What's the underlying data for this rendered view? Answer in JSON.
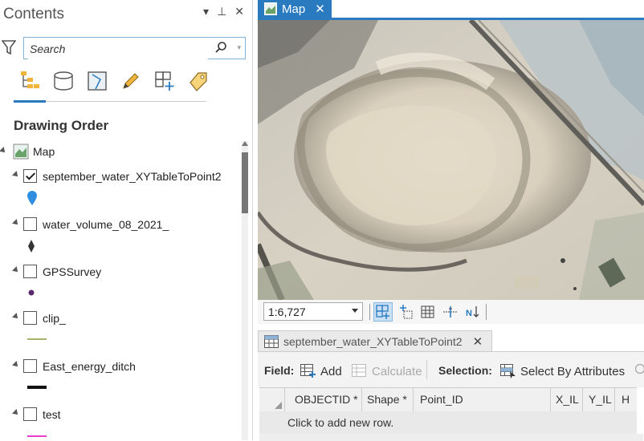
{
  "contents": {
    "title": "Contents",
    "search_placeholder": "Search",
    "section_title": "Drawing Order",
    "map_label": "Map",
    "layers": [
      {
        "label": "september_water_XYTableToPoint2",
        "checked": true,
        "symbol": "blue-pin"
      },
      {
        "label": "water_volume_08_2021_",
        "checked": false,
        "symbol": "black-diamond"
      },
      {
        "label": "GPSSurvey",
        "checked": false,
        "symbol": "purple-dot"
      },
      {
        "label": "clip_",
        "checked": false,
        "symbol": "olive-line"
      },
      {
        "label": "East_energy_ditch",
        "checked": false,
        "symbol": "black-thick-line"
      },
      {
        "label": "test",
        "checked": false,
        "symbol": "pink-line"
      }
    ]
  },
  "map": {
    "tab_label": "Map",
    "scale": "1:6,727"
  },
  "table": {
    "tab_label": "september_water_XYTableToPoint2",
    "field_label": "Field:",
    "add_label": "Add",
    "calculate_label": "Calculate",
    "selection_label": "Selection:",
    "select_by_attributes_label": "Select By Attributes",
    "columns": [
      "OBJECTID *",
      "Shape *",
      "Point_ID",
      "X_IL",
      "Y_IL",
      "H"
    ],
    "new_row_text": "Click to add new row."
  },
  "colors": {
    "accent": "#2a7ac0",
    "pin": "#2f8ee0",
    "purple": "#5b2a6e",
    "olive": "#a7b26b",
    "pink": "#e83fd1"
  }
}
